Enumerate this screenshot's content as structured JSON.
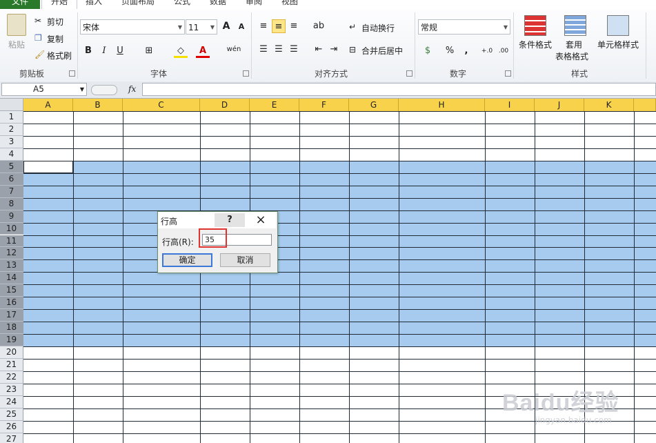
{
  "tabs": [
    "文件",
    "开始",
    "插入",
    "页面布局",
    "公式",
    "数据",
    "审阅",
    "视图"
  ],
  "ribbon": {
    "clipboard": {
      "paste": "粘贴",
      "cut": "剪切",
      "copy": "复制",
      "format_painter": "格式刷",
      "label": "剪贴板"
    },
    "font": {
      "name": "宋体",
      "size": "11",
      "label": "字体",
      "bold": "B",
      "italic": "I",
      "underline": "U",
      "grow": "A",
      "shrink": "A",
      "phonetic": "wén"
    },
    "alignment": {
      "wrap": "自动换行",
      "merge": "合并后居中",
      "label": "对齐方式"
    },
    "number": {
      "format": "常规",
      "percent": "%",
      "comma": ",",
      "inc": "+.0",
      "dec": ".00",
      "label": "数字"
    },
    "styles": {
      "conditional": "条件格式",
      "table_1": "套用",
      "table_2": "表格格式",
      "cell_styles": "单元格样式",
      "label": "样式"
    }
  },
  "formula_bar": {
    "name_box": "A5",
    "fx": "fx",
    "value": ""
  },
  "columns": [
    "A",
    "B",
    "C",
    "D",
    "E",
    "F",
    "G",
    "H",
    "I",
    "J",
    "K"
  ],
  "rows": [
    "1",
    "2",
    "3",
    "4",
    "5",
    "6",
    "7",
    "8",
    "9",
    "10",
    "11",
    "12",
    "13",
    "14",
    "15",
    "16",
    "17",
    "18",
    "19",
    "20",
    "21",
    "22",
    "23",
    "24",
    "25",
    "26",
    "27"
  ],
  "selected_rows": [
    "5",
    "6",
    "7",
    "8",
    "9",
    "10",
    "11",
    "12",
    "13",
    "14",
    "15",
    "16",
    "17",
    "18",
    "19"
  ],
  "dialog": {
    "title": "行高",
    "help": "?",
    "close": "×",
    "label": "行高(R):",
    "value": "35",
    "ok": "确定",
    "cancel": "取消"
  },
  "watermark": {
    "text": "Baidu经验",
    "url": "jingyan.baidu.com"
  },
  "colors": {
    "file_tab": "#2b7a2b",
    "selection": "#a6cbee",
    "header_highlight": "#f8d24a",
    "highlight_box": "#e0322f"
  }
}
